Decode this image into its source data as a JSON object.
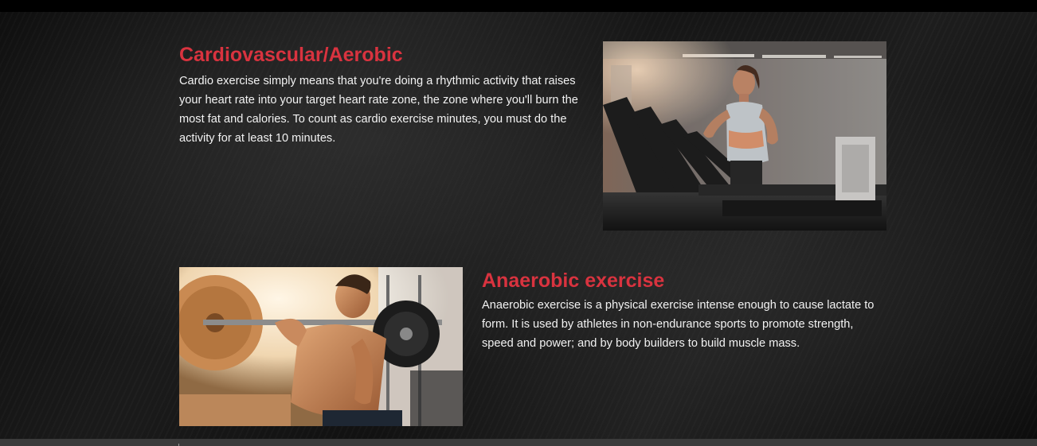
{
  "sections": [
    {
      "title": "Cardiovascular/Aerobic",
      "text": "Cardio exercise simply means that you're doing a rhythmic activity that raises your heart rate into your target heart rate zone, the zone where you'll burn the most fat and calories. To count as cardio exercise minutes, you must do the activity for at least 10 minutes."
    },
    {
      "title": "Anaerobic exercise",
      "text": "Anaerobic exercise is a physical exercise intense enough to cause lactate to form. It is used by athletes in non-endurance sports to promote strength, speed and power; and by body builders to build muscle mass."
    }
  ],
  "colors": {
    "title_red": "#d9333f",
    "body_text": "#f2f2f2",
    "background": "#000000",
    "bottom_bar": "#3b3b3b"
  }
}
